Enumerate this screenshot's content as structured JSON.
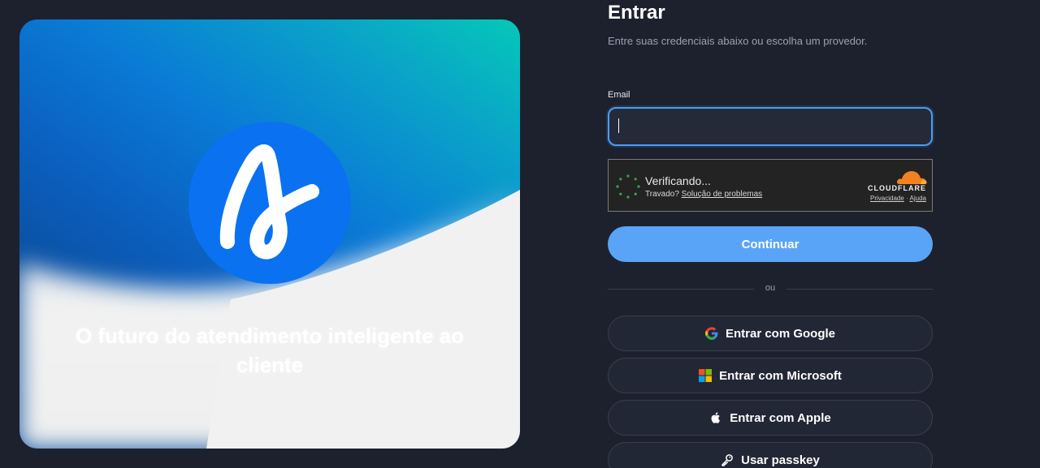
{
  "hero": {
    "tagline": "O futuro do atendimento inteligente ao cliente"
  },
  "form": {
    "title": "Entrar",
    "subtitle": "Entre suas credenciais abaixo ou escolha um provedor.",
    "email_label": "Email",
    "email_value": "",
    "email_placeholder": ""
  },
  "captcha": {
    "status": "Verificando...",
    "stuck_text": "Travado?",
    "troubleshoot_link": "Solução de problemas",
    "brand": "CLOUDFLARE",
    "privacy_link": "Privacidade",
    "separator": "·",
    "help_link": "Ajuda"
  },
  "buttons": {
    "continue": "Continuar",
    "divider": "ou",
    "google": "Entrar com Google",
    "microsoft": "Entrar com Microsoft",
    "apple": "Entrar com Apple",
    "passkey": "Usar passkey"
  },
  "colors": {
    "background": "#1d212e",
    "accent": "#5aa4f7",
    "input_border": "#4b9cf5",
    "logo_blue": "#0a72f0",
    "cloudflare_orange": "#f48120"
  },
  "icons": {
    "google": "google-icon",
    "microsoft": "microsoft-icon",
    "apple": "apple-icon",
    "passkey": "key-icon",
    "logo": "brand-logo-icon"
  }
}
